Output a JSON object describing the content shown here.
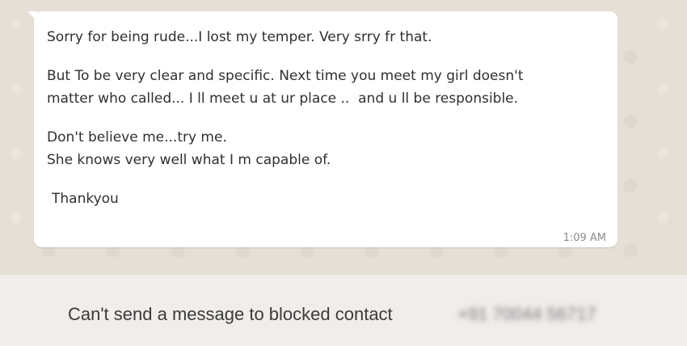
{
  "message": {
    "lines": [
      "Sorry for being rude...I lost my temper. Very srry fr that.",
      "",
      "But To be very clear and specific. Next time you meet my girl doesn't",
      "matter who called... I ll meet u at ur place ..  and u ll be responsible.",
      "",
      "Don't believe me...try me.",
      "She knows very well what I m capable of.",
      "",
      "Thankyou"
    ],
    "time": "1:09 AM"
  },
  "footer": {
    "blocked_text": "Can't send a message to blocked contact",
    "contact_number": "+91 70044 56717"
  }
}
